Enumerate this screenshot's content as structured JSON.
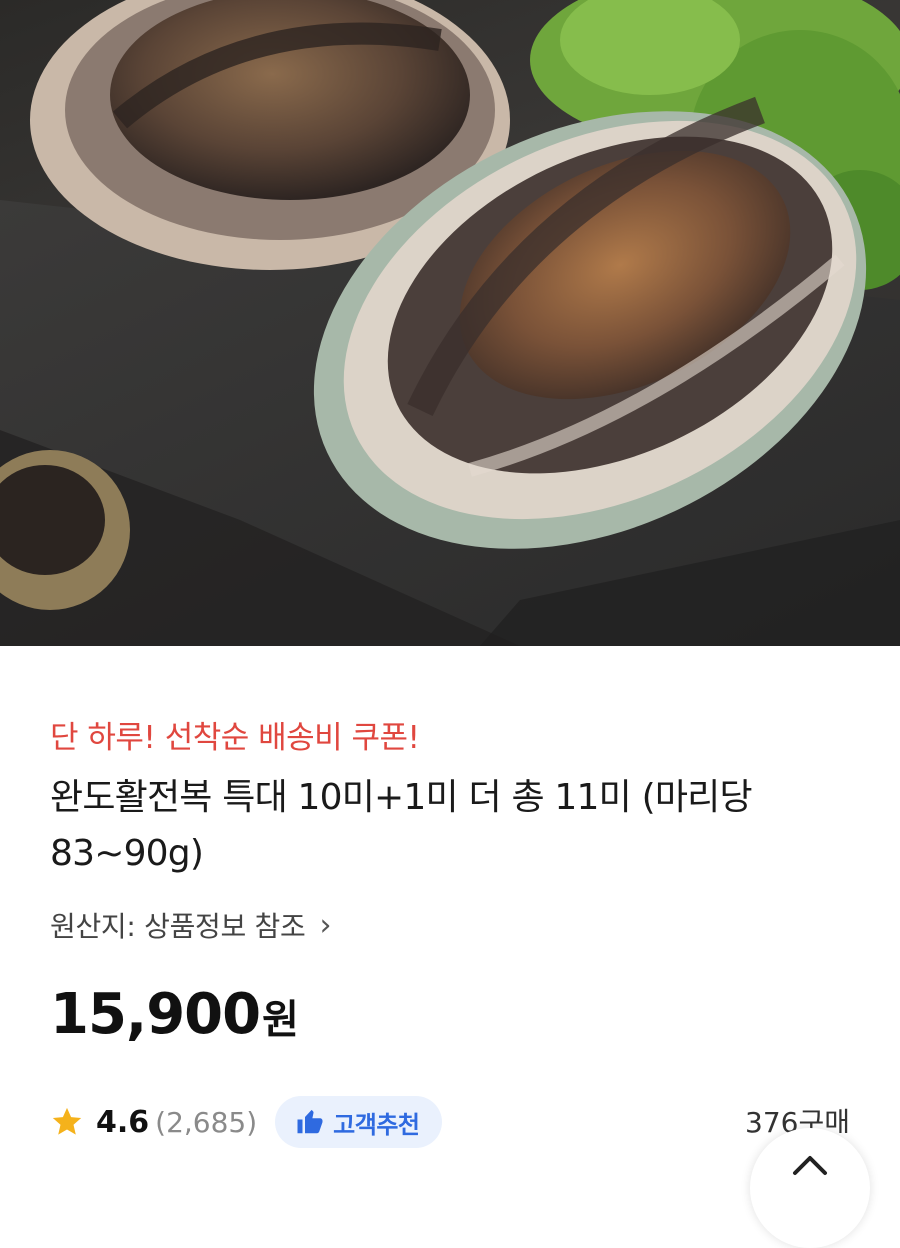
{
  "hero_image": {
    "subject": "abalone-on-slate-photo"
  },
  "promo": {
    "text": "단 하루! 선착순 배송비 쿠폰!",
    "color": "#e0473f"
  },
  "product": {
    "title": "완도활전복 특대 10미+1미 더 총 11미 (마리당 83~90g)",
    "origin_label": "원산지: 상품정보 참조",
    "origin_icon": "chevron-right-icon",
    "price": "15,900",
    "price_unit": "원"
  },
  "rating": {
    "icon": "star-icon",
    "score": "4.6",
    "count": "(2,685)",
    "star_color": "#f5b21b"
  },
  "badge": {
    "icon": "thumbs-up-icon",
    "label": "고객추천",
    "color": "#2f6ae0",
    "bg": "#eaf1fd"
  },
  "sold": {
    "text": "376구매"
  },
  "scroll_top": {
    "icon": "chevron-up-icon"
  }
}
